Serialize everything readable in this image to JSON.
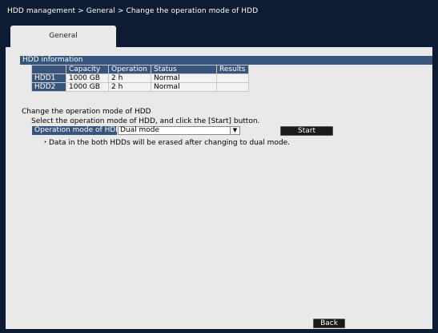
{
  "breadcrumb": "HDD management > General > Change the operation mode of HDD",
  "tabs": [
    {
      "label": "General"
    }
  ],
  "hdd_info": {
    "heading": "HDD information",
    "columns": [
      "Capacity",
      "Operation",
      "Status",
      "Results"
    ],
    "rows": [
      {
        "name": "HDD1",
        "capacity": "1000 GB",
        "operation": "2 h",
        "status": "Normal",
        "results": ""
      },
      {
        "name": "HDD2",
        "capacity": "1000 GB",
        "operation": "2 h",
        "status": "Normal",
        "results": ""
      }
    ]
  },
  "change_mode": {
    "title": "Change the operation mode of HDD",
    "description": "Select the operation mode of HDD, and click the [Start] button.",
    "label": "Operation mode of HDD",
    "selected": "Dual mode",
    "start_label": "Start",
    "note": "・Data in the both HDDs will be erased after changing to dual mode."
  },
  "footer": {
    "back_label": "Back"
  },
  "colors": {
    "background": "#0d1c33",
    "panel": "#e9e9e9",
    "header_blue": "#38557d",
    "button": "#1a1a1a"
  }
}
